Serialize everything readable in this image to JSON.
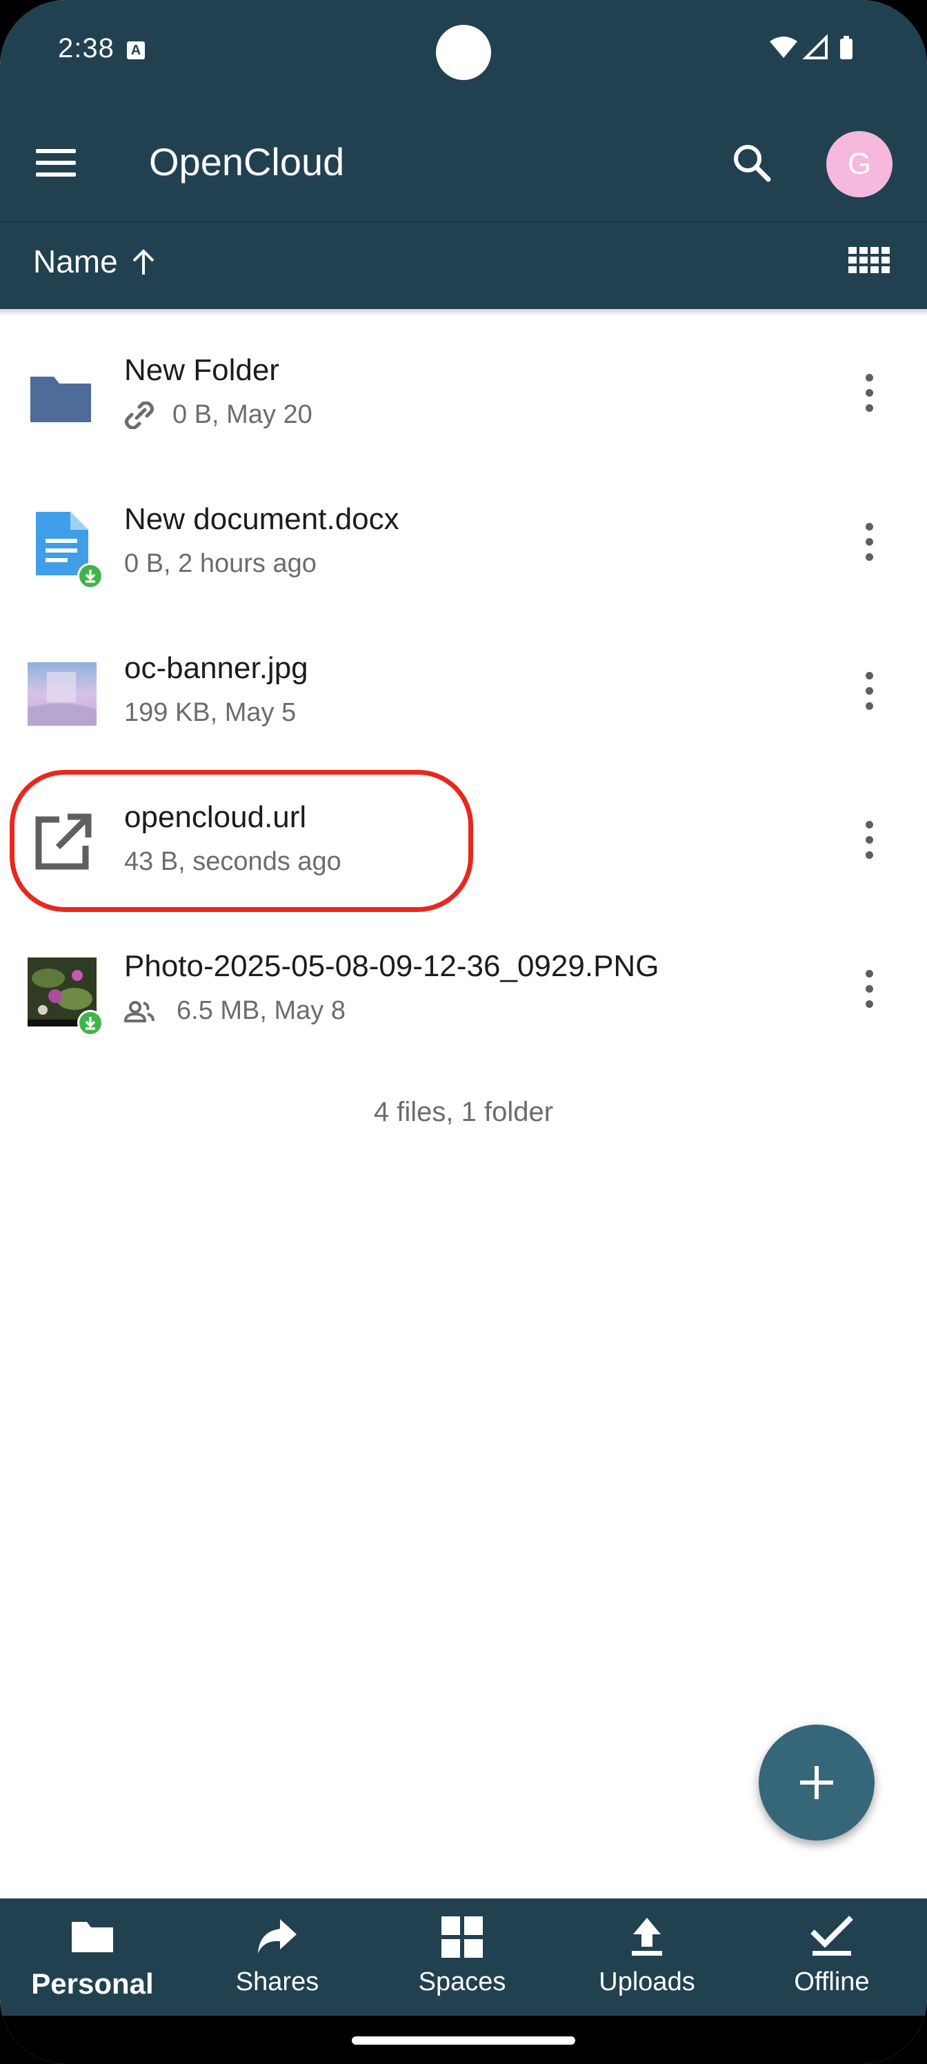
{
  "status_bar": {
    "time": "2:38",
    "notification_glyph": "A"
  },
  "app_bar": {
    "title": "OpenCloud",
    "avatar_initial": "G"
  },
  "sort_bar": {
    "label": "Name",
    "direction_icon": "arrow-up-icon",
    "view_toggle_icon": "grid-view-icon"
  },
  "files": [
    {
      "name": "New Folder",
      "meta": "0 B, May 20",
      "icon": "folder-icon",
      "meta_icon": "link-icon"
    },
    {
      "name": "New document.docx",
      "meta": "0 B, 2 hours ago",
      "icon": "document-icon",
      "badge": "download-badge-icon"
    },
    {
      "name": "oc-banner.jpg",
      "meta": "199 KB, May 5",
      "icon": "image-thumbnail"
    },
    {
      "name": "opencloud.url",
      "meta": "43 B, seconds ago",
      "icon": "open-external-icon"
    },
    {
      "name": "Photo-2025-05-08-09-12-36_0929.PNG",
      "meta": "6.5 MB, May 8",
      "icon": "photo-thumbnail",
      "badge": "download-badge-icon",
      "meta_icon": "shared-people-icon"
    }
  ],
  "summary": "4 files, 1 folder",
  "fab": {
    "icon": "plus-icon"
  },
  "bottom_nav": [
    {
      "label": "Personal",
      "icon": "folder-icon",
      "active": true
    },
    {
      "label": "Shares",
      "icon": "share-arrow-icon"
    },
    {
      "label": "Spaces",
      "icon": "spaces-grid-icon"
    },
    {
      "label": "Uploads",
      "icon": "upload-icon"
    },
    {
      "label": "Offline",
      "icon": "offline-check-icon"
    }
  ],
  "colors": {
    "primary": "#224150",
    "fab": "#366779",
    "highlight": "#e8281d",
    "badge": "#41b34a"
  }
}
